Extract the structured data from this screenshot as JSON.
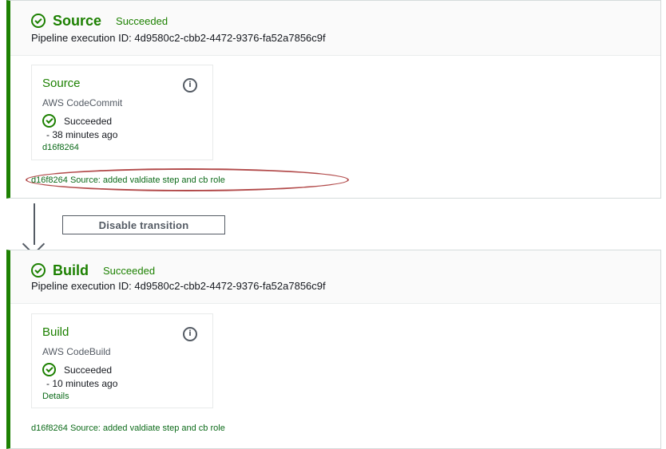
{
  "stages": [
    {
      "name": "Source",
      "status": "Succeeded",
      "execution_label": "Pipeline execution ID:",
      "execution_id": "4d9580c2-cbb2-4472-9376-fa52a7856c9f",
      "action": {
        "name": "Source",
        "provider": "AWS CodeCommit",
        "status": "Succeeded",
        "time": "- 38 minutes ago",
        "link": "d16f8264",
        "icon": "info-icon"
      },
      "commit_id": "d16f8264",
      "commit_message": "Source: added valdiate step and cb role"
    },
    {
      "name": "Build",
      "status": "Succeeded",
      "execution_label": "Pipeline execution ID:",
      "execution_id": "4d9580c2-cbb2-4472-9376-fa52a7856c9f",
      "action": {
        "name": "Build",
        "provider": "AWS CodeBuild",
        "status": "Succeeded",
        "time": "- 10 minutes ago",
        "link": "Details",
        "icon": "info-icon"
      },
      "commit_id": "d16f8264",
      "commit_message": "Source: added valdiate step and cb role"
    }
  ],
  "transition": {
    "button_label": "Disable transition"
  },
  "colors": {
    "success": "#1d8102",
    "highlight": "#b24a4a",
    "neutral": "#545b64"
  }
}
